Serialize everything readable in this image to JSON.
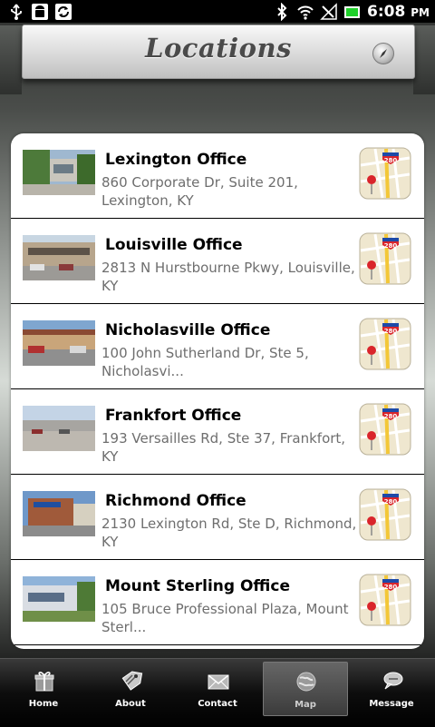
{
  "status_bar": {
    "time": "6:08",
    "ampm": "PM",
    "left_icons": [
      "usb-icon",
      "android-debug-icon",
      "sync-icon"
    ],
    "right_icons": [
      "bluetooth-icon",
      "wifi-icon",
      "signal-icon",
      "battery-icon"
    ]
  },
  "header": {
    "title": "Locations",
    "action_icon": "compass-icon"
  },
  "locations": [
    {
      "name": "Lexington Office",
      "address": "860 Corporate Dr, Suite 201, Lexington, KY"
    },
    {
      "name": "Louisville Office",
      "address": "2813 N Hurstbourne Pkwy, Louisville, KY"
    },
    {
      "name": "Nicholasville Office",
      "address": "100 John Sutherland Dr, Ste 5, Nicholasvi..."
    },
    {
      "name": "Frankfort Office",
      "address": "193 Versailles Rd, Ste 37, Frankfort, KY"
    },
    {
      "name": "Richmond Office",
      "address": "2130 Lexington Rd, Ste D, Richmond, KY"
    },
    {
      "name": "Mount Sterling Office",
      "address": "105 Bruce Professional Plaza, Mount Sterl..."
    }
  ],
  "map_badge": "280",
  "tabs": [
    {
      "label": "Home",
      "icon": "gift-icon"
    },
    {
      "label": "About",
      "icon": "tag-icon"
    },
    {
      "label": "Contact",
      "icon": "envelope-icon"
    },
    {
      "label": "Map",
      "icon": "globe-icon",
      "active": true
    },
    {
      "label": "Message",
      "icon": "chat-bubble-icon"
    }
  ],
  "colors": {
    "accent_green": "#1fd12a",
    "map_red": "#d9252b",
    "map_yellow": "#f3c737"
  }
}
